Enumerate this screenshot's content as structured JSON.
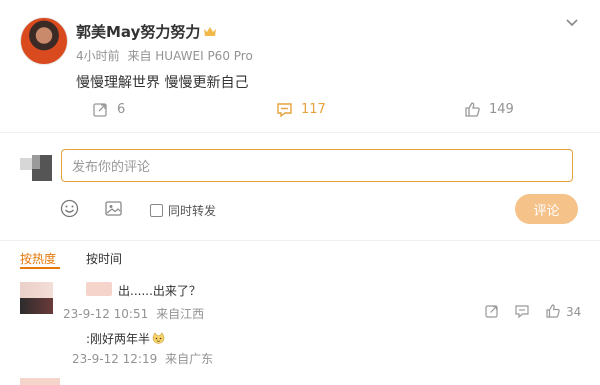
{
  "post": {
    "author": "郭美May努力努力",
    "time": "4小时前",
    "source": "来自 HUAWEI P60 Pro",
    "text": "慢慢理解世界 慢慢更新自己",
    "repost_count": "6",
    "comment_count": "117",
    "like_count": "149"
  },
  "composer": {
    "placeholder": "发布你的评论",
    "repost_label": "同时转发",
    "submit_label": "评论"
  },
  "sort": {
    "hot_label": "按热度",
    "time_label": "按时间"
  },
  "comment": {
    "text": "出......出来了？",
    "time": "23-9-12 10:51",
    "source": "来自江西",
    "like_count": "34"
  },
  "reply": {
    "text": ":刚好两年半",
    "time": "23-9-12 12:19",
    "source": "来自广东"
  },
  "colors": {
    "accent": "#e6a23c",
    "hot": "#e6770a",
    "submit_bg": "#f5c28a",
    "meta": "#939393"
  },
  "icons": [
    "crown-icon",
    "chevron-down-icon",
    "repost-icon",
    "comment-icon",
    "like-icon",
    "emoji-icon",
    "picture-icon",
    "share-icon",
    "reply-icon"
  ]
}
